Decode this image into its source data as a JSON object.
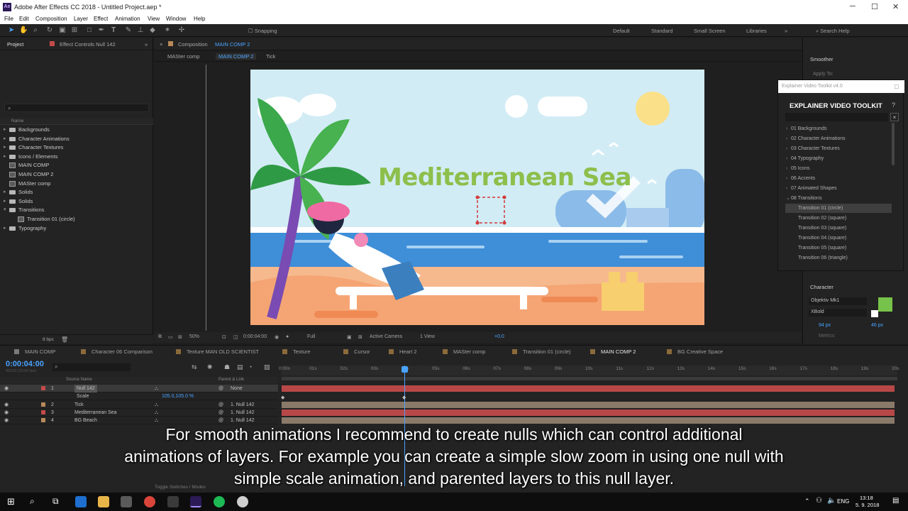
{
  "window": {
    "title": "Adobe After Effects CC 2018 - Untitled Project.aep *",
    "app_icon": "Ae"
  },
  "menu": [
    "File",
    "Edit",
    "Composition",
    "Layer",
    "Effect",
    "Animation",
    "View",
    "Window",
    "Help"
  ],
  "toolbar": {
    "snapping": "Snapping",
    "workspaces": [
      "Default",
      "Standard",
      "Small Screen",
      "Libraries"
    ],
    "search_help": "Search Help"
  },
  "project_panel": {
    "tab_project": "Project",
    "tab_effect_controls": "Effect Controls Null 142",
    "column_name": "Name",
    "items": [
      {
        "type": "folder",
        "label": "Backgrounds",
        "arrow": "▸"
      },
      {
        "type": "folder",
        "label": "Character Animations",
        "arrow": "▸"
      },
      {
        "type": "folder",
        "label": "Character Textures",
        "arrow": "▸"
      },
      {
        "type": "folder",
        "label": "Icons / Elements",
        "arrow": "▸"
      },
      {
        "type": "comp",
        "label": "MAIN COMP",
        "arrow": ""
      },
      {
        "type": "comp",
        "label": "MAIN COMP 2",
        "arrow": ""
      },
      {
        "type": "comp",
        "label": "MASter comp",
        "arrow": ""
      },
      {
        "type": "folder",
        "label": "Solids",
        "arrow": "▸"
      },
      {
        "type": "folder",
        "label": "Solids",
        "arrow": "▸"
      },
      {
        "type": "folder",
        "label": "Transitions",
        "arrow": "▾"
      },
      {
        "type": "comp",
        "label": "Transition 01 (circle)",
        "arrow": "",
        "indent": true
      },
      {
        "type": "folder",
        "label": "Typography",
        "arrow": "▸"
      }
    ],
    "bpc": "8 bpc"
  },
  "viewer": {
    "tab_label": "Composition",
    "tab_comp": "MAIN COMP 2",
    "breadcrumbs": [
      "MASter comp",
      "MAIN COMP 2",
      "Tick"
    ],
    "headline": "Mediterranean Sea",
    "zoom": "50%",
    "timecode": "0:00:04:00",
    "resolution": "Full",
    "camera": "Active Camera",
    "views": "1 View",
    "exposure": "+0.0"
  },
  "right_panel": {
    "smoother": "Smoother",
    "apply_to": "Apply To:",
    "character": "Character",
    "font": "Objektiv Mk1",
    "style": "XBold",
    "size": "94 px",
    "leading": "46 px",
    "metrics": "Metrics"
  },
  "evt_panel": {
    "header": "Explainer Video Toolkit v4.0",
    "title": "EXPLAINER VIDEO TOOLKIT",
    "items": [
      {
        "label": "01 Backgrounds",
        "arrow": "›"
      },
      {
        "label": "02 Character Animations",
        "arrow": "›"
      },
      {
        "label": "03 Character Textures",
        "arrow": "›"
      },
      {
        "label": "04 Typography",
        "arrow": "›"
      },
      {
        "label": "05 Icons",
        "arrow": "›"
      },
      {
        "label": "06 Accents",
        "arrow": "›"
      },
      {
        "label": "07 Animated Shapes",
        "arrow": "›"
      },
      {
        "label": "08 Transitions",
        "arrow": "⌄"
      },
      {
        "label": "Transition 01 (circle)",
        "arrow": "",
        "selected": true,
        "sub": true
      },
      {
        "label": "Transition 02 (square)",
        "arrow": "",
        "sub": true
      },
      {
        "label": "Transition 03 (square)",
        "arrow": "",
        "sub": true
      },
      {
        "label": "Transition 04 (square)",
        "arrow": "",
        "sub": true
      },
      {
        "label": "Transition 05 (square)",
        "arrow": "",
        "sub": true
      },
      {
        "label": "Transition 06 (triangle)",
        "arrow": "",
        "sub": true
      }
    ]
  },
  "timeline": {
    "tabs": [
      {
        "label": "MAIN COMP",
        "color": "#7a7a7a"
      },
      {
        "label": "Character 06 Comparison",
        "color": "#8a6a3a"
      },
      {
        "label": "Texture MAN OLD SCIENTIST",
        "color": "#8a6a3a"
      },
      {
        "label": "Texture",
        "color": "#8a6a3a"
      },
      {
        "label": "Cursor",
        "color": "#8a6a3a"
      },
      {
        "label": "Heart 2",
        "color": "#8a6a3a"
      },
      {
        "label": "MASter comp",
        "color": "#8a6a3a"
      },
      {
        "label": "Transition 01 (circle)",
        "color": "#8a6a3a"
      },
      {
        "label": "MAIN COMP 2",
        "color": "#8a6a3a",
        "active": true
      },
      {
        "label": "BG Creative Space",
        "color": "#8a6a3a"
      }
    ],
    "timecode": "0:00:04:00",
    "fps": "00100 (25.00 fps)",
    "col_source": "Source Name",
    "col_parent": "Parent & Link",
    "layers": [
      {
        "num": "1",
        "name": "Null 142",
        "parent": "None",
        "color": "#c44a4a",
        "bar": "#b84848"
      },
      {
        "num": "",
        "name": "Scale",
        "parent": "",
        "value": "105.0,105.0 %",
        "bar": ""
      },
      {
        "num": "2",
        "name": "Tick",
        "parent": "1. Null 142",
        "color": "#b88a5a",
        "bar": "#8a7a6a"
      },
      {
        "num": "3",
        "name": "Mediterranean Sea",
        "parent": "1. Null 142",
        "color": "#c44a4a",
        "bar": "#b84848"
      },
      {
        "num": "4",
        "name": "BG Beach",
        "parent": "1. Null 142",
        "color": "#b88a5a",
        "bar": "#8a7a6a"
      }
    ],
    "ruler": [
      "0:00s",
      "01s",
      "02s",
      "03s",
      "04s",
      "05s",
      "06s",
      "07s",
      "08s",
      "09s",
      "10s",
      "11s",
      "12s",
      "13s",
      "14s",
      "15s",
      "16s",
      "17s",
      "18s",
      "19s",
      "20s"
    ],
    "toggle": "Toggle Switches / Modes"
  },
  "subtitle": {
    "line1": "For smooth animations I recommend to create nulls which can control additional",
    "line2": "animations of layers. For example you can create a simple slow zoom in using one null with",
    "line3": "simple scale animation, and parented layers to this null layer."
  },
  "taskbar": {
    "lang": "ENG",
    "time": "13:18",
    "date": "5. 9. 2018"
  }
}
